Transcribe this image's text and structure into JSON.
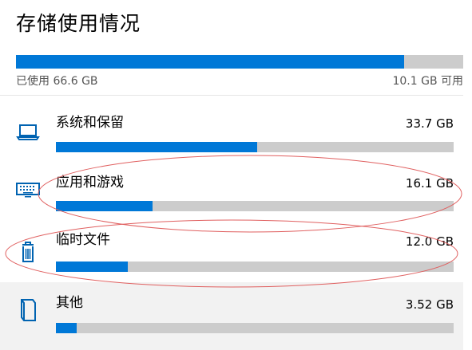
{
  "title": "存储使用情况",
  "summary": {
    "used_label": "已使用 66.6 GB",
    "free_label": "10.1 GB 可用",
    "used_fraction": 0.868
  },
  "categories": [
    {
      "label": "系统和保留",
      "size": "33.7 GB",
      "fill": 0.506,
      "icon": "laptop-icon"
    },
    {
      "label": "应用和游戏",
      "size": "16.1 GB",
      "fill": 0.242,
      "icon": "keyboard-icon"
    },
    {
      "label": "临时文件",
      "size": "12.0 GB",
      "fill": 0.181,
      "icon": "trash-icon"
    },
    {
      "label": "其他",
      "size": "3.52 GB",
      "fill": 0.053,
      "icon": "folder-icon"
    }
  ],
  "colors": {
    "accent": "#0078d7",
    "track": "#cccccc",
    "annotation": "#e06060"
  }
}
